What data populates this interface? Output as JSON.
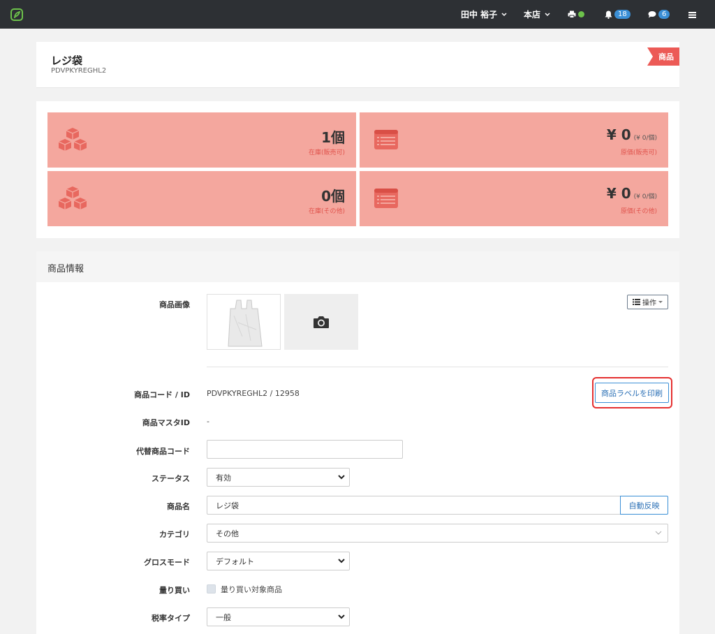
{
  "navbar": {
    "user": "田中 裕子",
    "store": "本店",
    "notifications_count": "18",
    "messages_count": "6"
  },
  "header": {
    "title": "レジ袋",
    "code": "PDVPKYREGHL2",
    "ribbon": "商品"
  },
  "stats": [
    {
      "value": "1個",
      "label": "在庫(販売可)"
    },
    {
      "value": "¥ 0",
      "sub": "(¥ 0/個)",
      "label": "原価(販売可)"
    },
    {
      "value": "0個",
      "label": "在庫(その他)"
    },
    {
      "value": "¥ 0",
      "sub": "(¥ 0/個)",
      "label": "原価(その他)"
    }
  ],
  "info": {
    "title": "商品情報",
    "image_label": "商品画像",
    "operation_button": "操作",
    "code_label": "商品コード / ID",
    "code_value": "PDVPKYREGHL2 / 12958",
    "print_label_button": "商品ラベルを印刷",
    "master_label": "商品マスタID",
    "master_value": "-",
    "alt_code_label": "代替商品コード",
    "alt_code_value": "",
    "status_label": "ステータス",
    "status_value": "有効",
    "name_label": "商品名",
    "name_value": "レジ袋",
    "auto_button": "自動反映",
    "category_label": "カテゴリ",
    "category_value": "その他",
    "gross_label": "グロスモード",
    "gross_value": "デフォルト",
    "buyback_label": "量り買い",
    "buyback_checkbox_label": "量り買い対象商品",
    "tax_label": "税率タイプ",
    "tax_value": "一般"
  },
  "colors": {
    "navbar": "#2d3034",
    "stat_bg": "#f4a79e",
    "accent_red": "#ec5a56",
    "accent_blue": "#3a8fd6",
    "highlight": "#e53030"
  }
}
